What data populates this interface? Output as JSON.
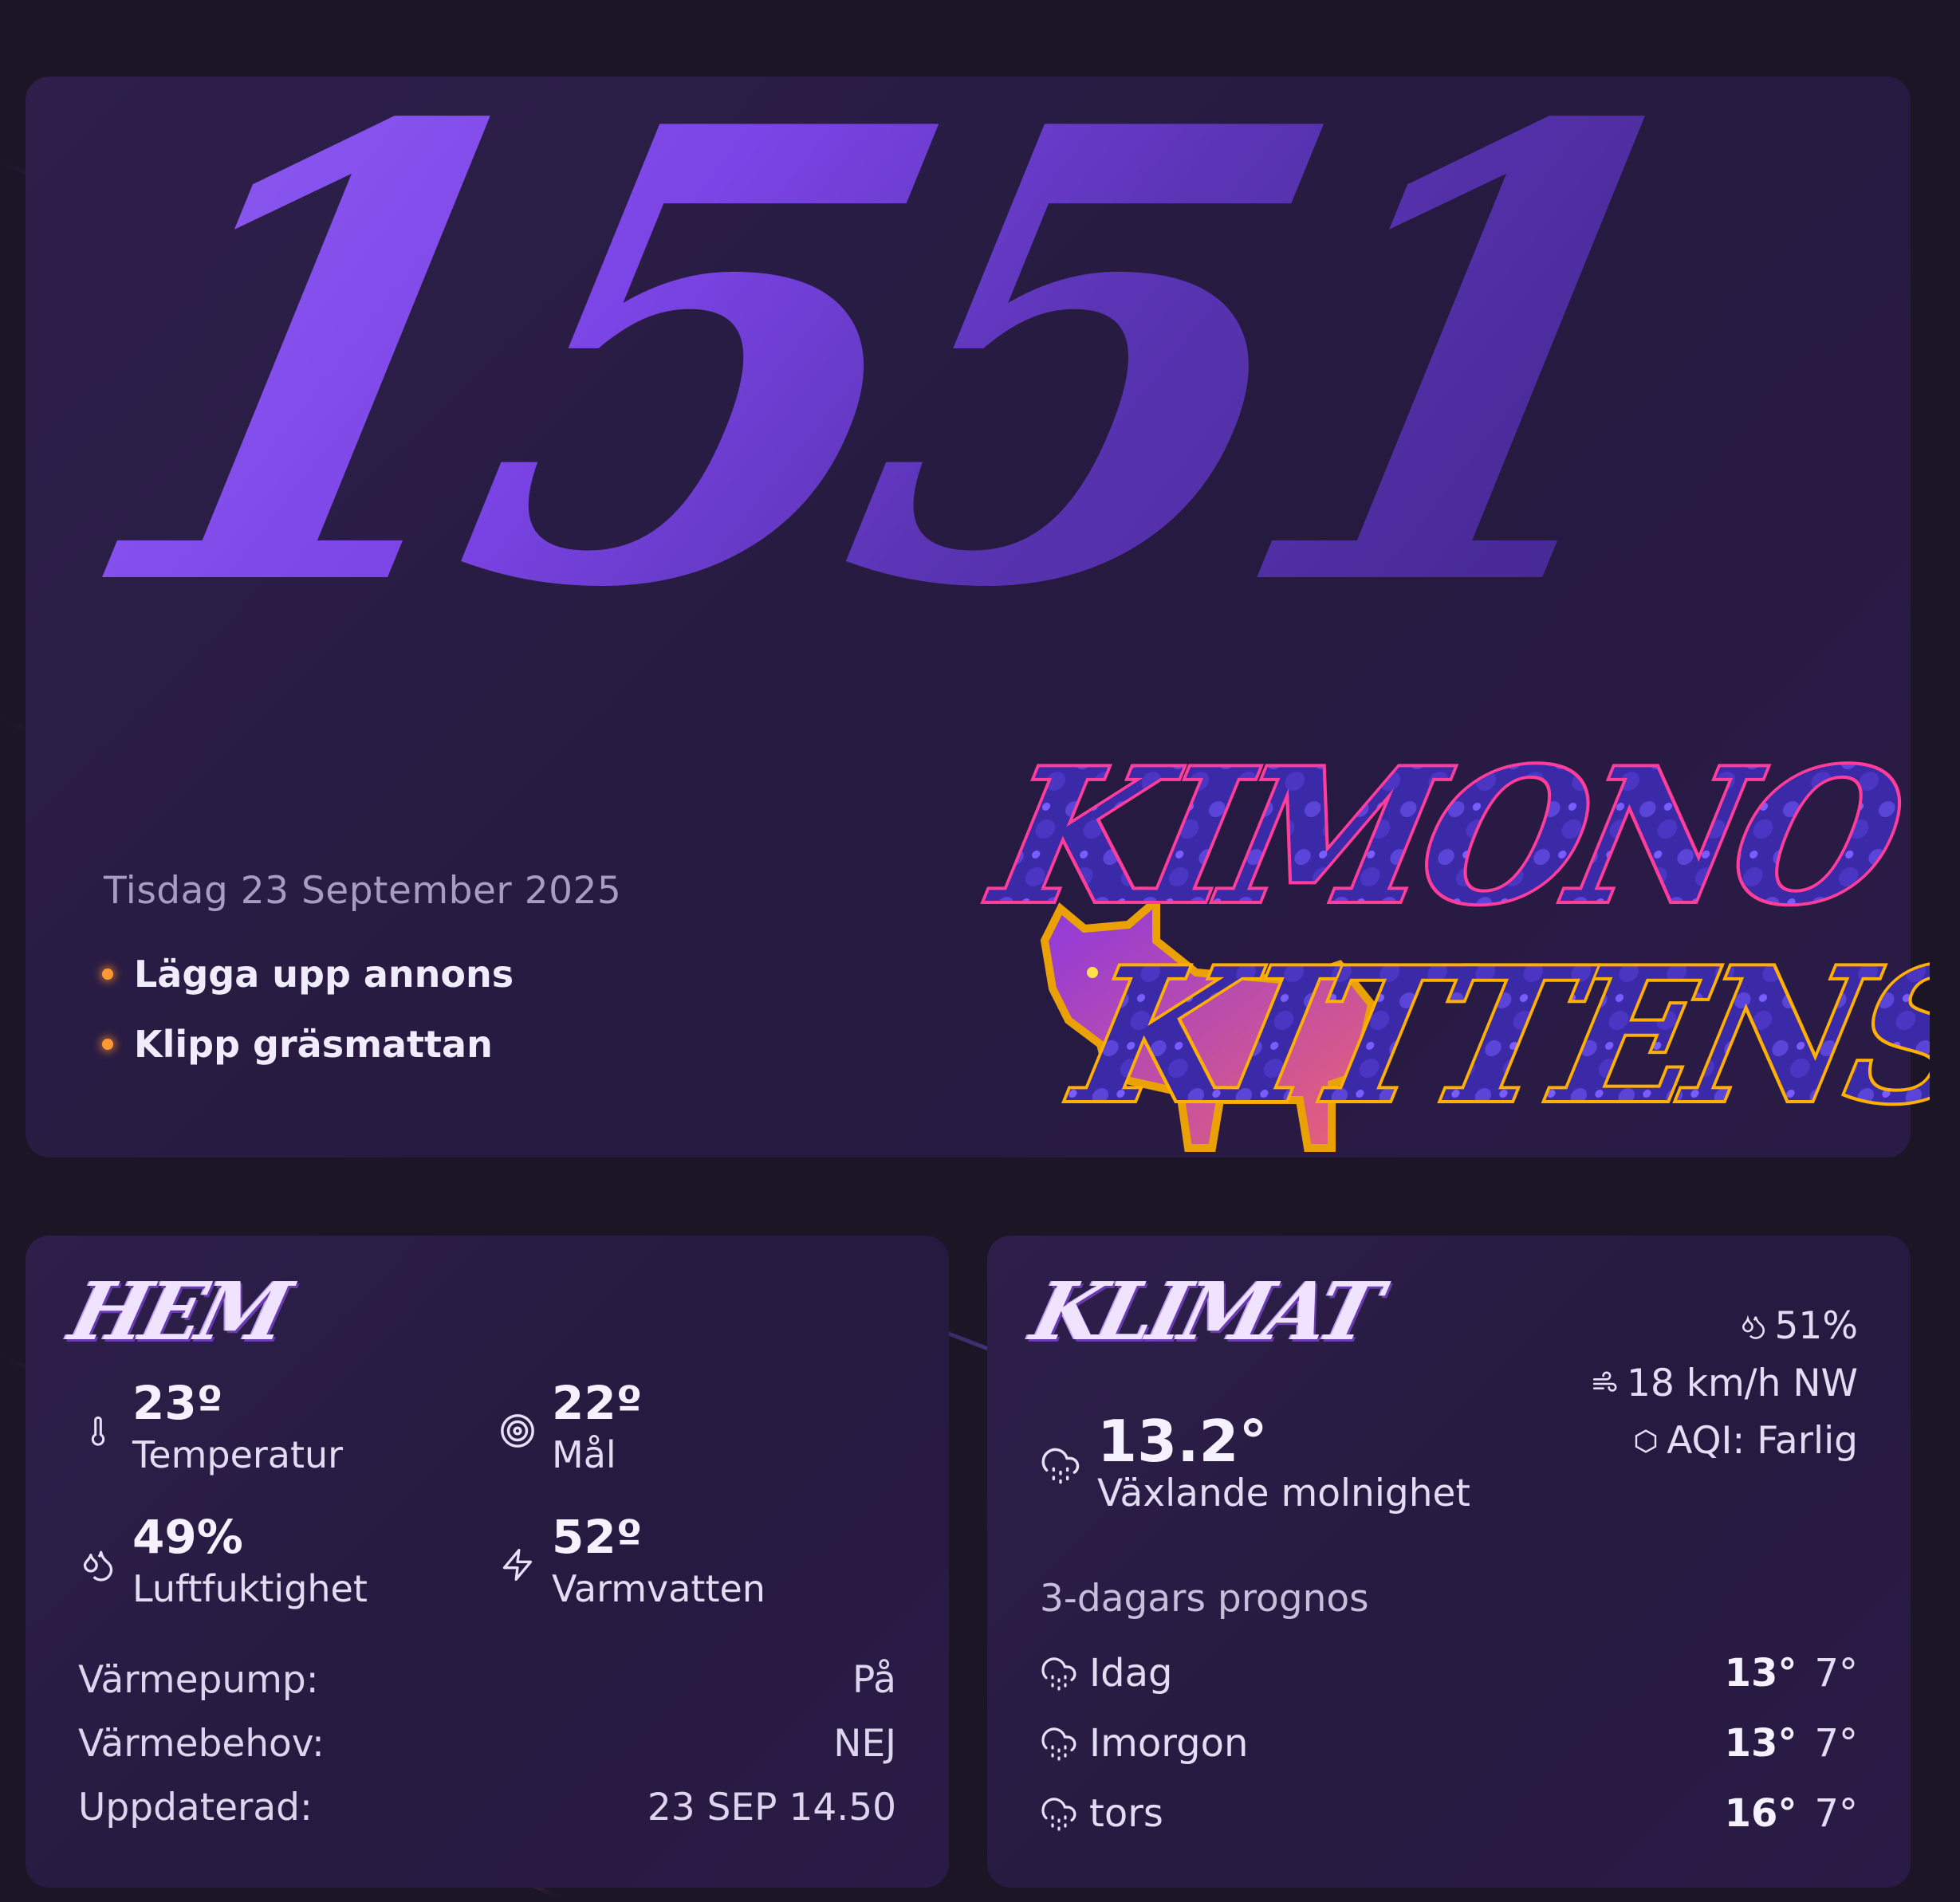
{
  "hero": {
    "time": "1551",
    "date": "Tisdag 23 September 2025",
    "tasks": [
      "Lägga upp annons",
      "Klipp gräsmattan"
    ],
    "logo": {
      "line1": "KIMONO",
      "line2": "KITTENS"
    }
  },
  "hem": {
    "title": "HEM",
    "metrics": {
      "temperature": {
        "value": "23º",
        "label": "Temperatur",
        "icon": "thermometer-icon"
      },
      "target": {
        "value": "22º",
        "label": "Mål",
        "icon": "target-icon"
      },
      "humidity": {
        "value": "49%",
        "label": "Luftfuktighet",
        "icon": "droplets-icon"
      },
      "hotwater": {
        "value": "52º",
        "label": "Varmvatten",
        "icon": "lightning-icon"
      }
    },
    "rows": [
      {
        "label": "Värmepump:",
        "value": "På"
      },
      {
        "label": "Värmebehov:",
        "value": "NEJ"
      },
      {
        "label": "Uppdaterad:",
        "value": "23 SEP 14.50"
      }
    ]
  },
  "klimat": {
    "title": "KLIMAT",
    "current": {
      "temp": "13.2°",
      "condition": "Växlande molnighet",
      "icon": "cloud-drizzle-icon"
    },
    "humidity": "51%",
    "wind": "18 km/h NW",
    "aqi": "AQI: Farlig",
    "forecast_title": "3-dagars prognos",
    "forecast": [
      {
        "day": "Idag",
        "high": "13°",
        "low": "7°"
      },
      {
        "day": "Imorgon",
        "high": "13°",
        "low": "7°"
      },
      {
        "day": "tors",
        "high": "16°",
        "low": "7°"
      }
    ]
  },
  "colors": {
    "accent": "#8e5cf2",
    "task_dot": "#ff9a33",
    "logo_outline": "#ffb000",
    "logo_pink": "#ff3d9a"
  }
}
